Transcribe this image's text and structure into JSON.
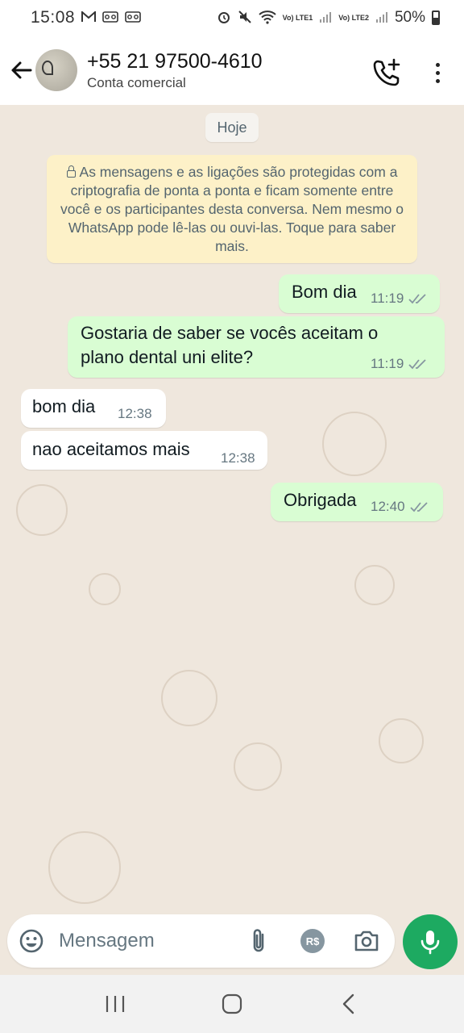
{
  "status_bar": {
    "time": "15:08",
    "battery": "50%",
    "lte1": "Vo) LTE1",
    "lte2": "Vo) LTE2"
  },
  "header": {
    "contact_name": "+55 21 97500-4610",
    "contact_subtitle": "Conta comercial"
  },
  "chat": {
    "date_chip": "Hoje",
    "encryption_notice": "As mensagens e as ligações são protegidas com a criptografia de ponta a ponta e ficam somente entre você e os participantes desta conversa. Nem mesmo o WhatsApp pode lê-las ou ouvi-las. Toque para saber mais.",
    "messages": [
      {
        "direction": "out",
        "text": "Bom dia",
        "time": "11:19",
        "status": "read"
      },
      {
        "direction": "out",
        "text": "Gostaria de saber se vocês aceitam o plano dental uni elite?",
        "time": "11:19",
        "status": "read"
      },
      {
        "direction": "in",
        "text": "bom dia",
        "time": "12:38"
      },
      {
        "direction": "in",
        "text": "nao aceitamos mais",
        "time": "12:38"
      },
      {
        "direction": "out",
        "text": "Obrigada",
        "time": "12:40",
        "status": "read"
      }
    ]
  },
  "input_bar": {
    "placeholder": "Mensagem",
    "payment_label": "R$"
  },
  "icons": {
    "back": "arrow-left-icon",
    "call": "add-call-icon",
    "menu": "more-vert-icon",
    "emoji": "emoji-icon",
    "attach": "paperclip-icon",
    "camera": "camera-icon",
    "mic": "mic-icon"
  },
  "colors": {
    "outgoing_bubble": "#d9fdd3",
    "incoming_bubble": "#ffffff",
    "notice_background": "#fdf1c8",
    "chat_background": "#efe7dd",
    "accent_green": "#1daa61"
  }
}
